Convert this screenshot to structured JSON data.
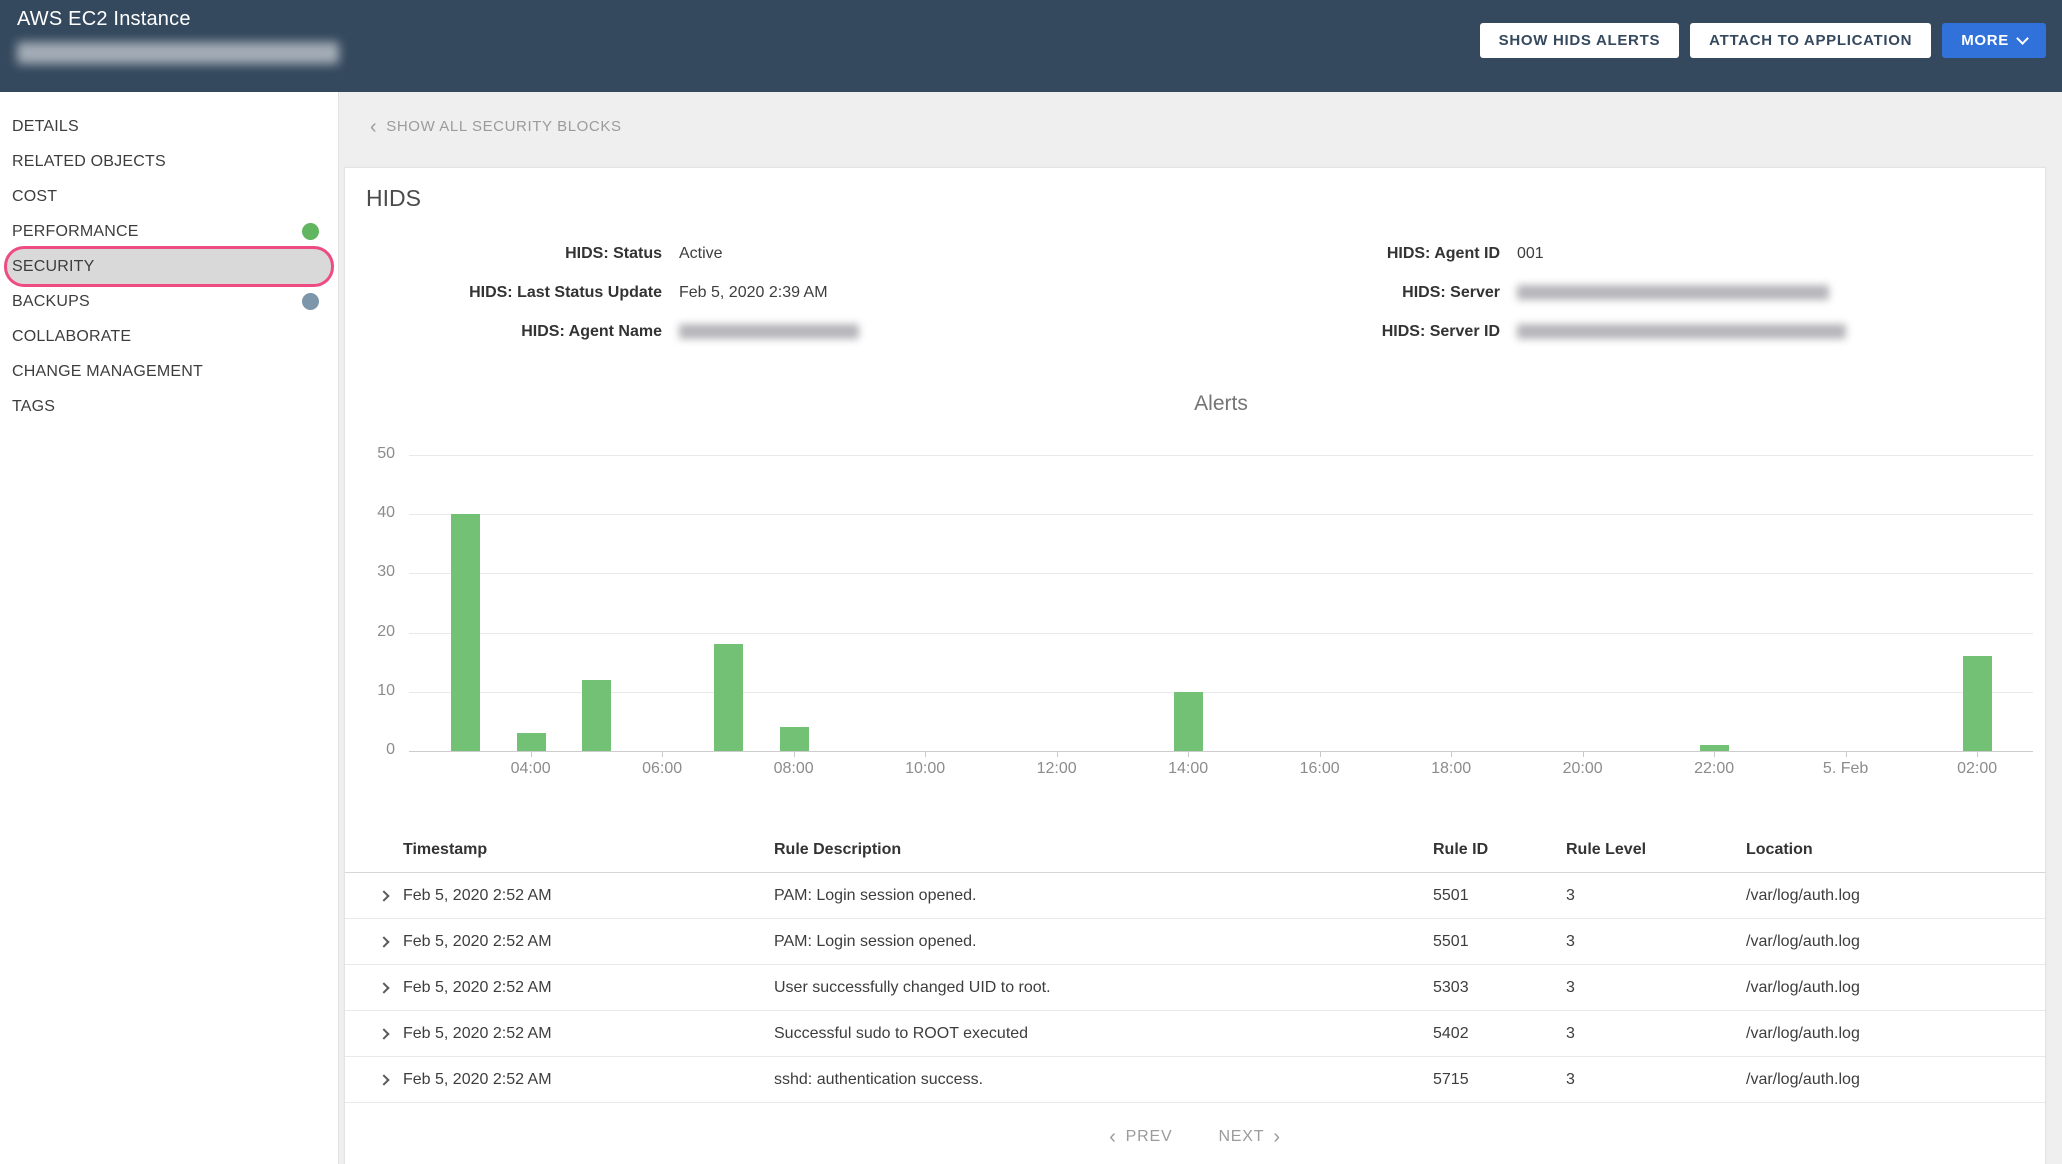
{
  "colors": {
    "header_bg": "#35495e",
    "accent_blue": "#3072d9",
    "bar_green": "#72c174",
    "highlight_ring": "#ee4b81"
  },
  "header": {
    "title": "AWS EC2 Instance",
    "buttons": {
      "show_hids_alerts": "SHOW HIDS ALERTS",
      "attach_to_application": "ATTACH TO APPLICATION",
      "more": "MORE"
    }
  },
  "sidebar": {
    "items": [
      {
        "label": "DETAILS"
      },
      {
        "label": "RELATED OBJECTS"
      },
      {
        "label": "COST"
      },
      {
        "label": "PERFORMANCE",
        "dot": "#62b561"
      },
      {
        "label": "SECURITY",
        "active": true
      },
      {
        "label": "BACKUPS",
        "dot": "#7e96a9"
      },
      {
        "label": "COLLABORATE"
      },
      {
        "label": "CHANGE MANAGEMENT"
      },
      {
        "label": "TAGS"
      }
    ]
  },
  "main": {
    "back_link": "SHOW ALL SECURITY BLOCKS",
    "card_title": "HIDS",
    "fields_left": [
      {
        "label": "HIDS: Status",
        "value": "Active"
      },
      {
        "label": "HIDS: Last Status Update",
        "value": "Feb 5, 2020 2:39 AM"
      },
      {
        "label": "HIDS: Agent Name",
        "redacted": true,
        "redacted_width": 180
      }
    ],
    "fields_right": [
      {
        "label": "HIDS: Agent ID",
        "value": "001"
      },
      {
        "label": "HIDS: Server",
        "redacted": true,
        "redacted_width": 312
      },
      {
        "label": "HIDS: Server ID",
        "redacted": true,
        "redacted_width": 329
      }
    ]
  },
  "chart_data": {
    "type": "bar",
    "title": "Alerts",
    "xlabel": "",
    "ylabel": "",
    "ylim": [
      0,
      50
    ],
    "y_ticks": [
      0,
      10,
      20,
      30,
      40,
      50
    ],
    "grid": true,
    "legend": false,
    "bar_color": "#72c174",
    "hour_domain": [
      2.15,
      26.85
    ],
    "x_ticks": [
      {
        "label": "04:00",
        "h": 4
      },
      {
        "label": "06:00",
        "h": 6
      },
      {
        "label": "08:00",
        "h": 8
      },
      {
        "label": "10:00",
        "h": 10
      },
      {
        "label": "12:00",
        "h": 12
      },
      {
        "label": "14:00",
        "h": 14
      },
      {
        "label": "16:00",
        "h": 16
      },
      {
        "label": "18:00",
        "h": 18
      },
      {
        "label": "20:00",
        "h": 20
      },
      {
        "label": "22:00",
        "h": 22
      },
      {
        "label": "5. Feb",
        "h": 24
      },
      {
        "label": "02:00",
        "h": 26
      }
    ],
    "bars": [
      {
        "time": "03:00",
        "h": 3,
        "value": 40
      },
      {
        "time": "04:00",
        "h": 4,
        "value": 3
      },
      {
        "time": "05:00",
        "h": 5,
        "value": 12
      },
      {
        "time": "07:00",
        "h": 7,
        "value": 18
      },
      {
        "time": "08:00",
        "h": 8,
        "value": 4
      },
      {
        "time": "14:00",
        "h": 14,
        "value": 10
      },
      {
        "time": "22:00",
        "h": 22,
        "value": 1
      },
      {
        "time": "02:00",
        "h": 26,
        "value": 16
      }
    ]
  },
  "table": {
    "columns": [
      "Timestamp",
      "Rule Description",
      "Rule ID",
      "Rule Level",
      "Location"
    ],
    "rows": [
      [
        "Feb 5, 2020 2:52 AM",
        "PAM: Login session opened.",
        "5501",
        "3",
        "/var/log/auth.log"
      ],
      [
        "Feb 5, 2020 2:52 AM",
        "PAM: Login session opened.",
        "5501",
        "3",
        "/var/log/auth.log"
      ],
      [
        "Feb 5, 2020 2:52 AM",
        "User successfully changed UID to root.",
        "5303",
        "3",
        "/var/log/auth.log"
      ],
      [
        "Feb 5, 2020 2:52 AM",
        "Successful sudo to ROOT executed",
        "5402",
        "3",
        "/var/log/auth.log"
      ],
      [
        "Feb 5, 2020 2:52 AM",
        "sshd: authentication success.",
        "5715",
        "3",
        "/var/log/auth.log"
      ]
    ]
  },
  "pagination": {
    "prev": "PREV",
    "next": "NEXT"
  }
}
